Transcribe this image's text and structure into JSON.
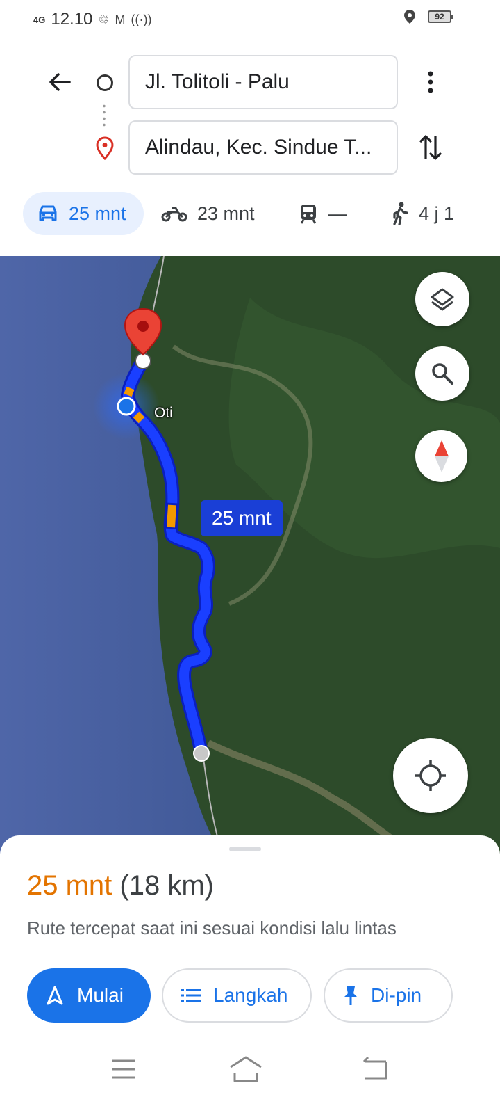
{
  "status_bar": {
    "network": "4G",
    "time": "12.10",
    "battery": "92"
  },
  "directions": {
    "origin": "Jl. Tolitoli - Palu",
    "destination": "Alindau, Kec. Sindue T..."
  },
  "modes": [
    {
      "name": "car",
      "label": "25 mnt",
      "active": true
    },
    {
      "name": "motorcycle",
      "label": "23 mnt",
      "active": false
    },
    {
      "name": "transit",
      "label": "—",
      "active": false
    },
    {
      "name": "walk",
      "label": "4 j 1",
      "active": false
    }
  ],
  "map": {
    "route_label": "25 mnt",
    "place_label": "Oti",
    "route_color": "#1a3fff",
    "traffic_color": "#f29900"
  },
  "sheet": {
    "duration": "25 mnt",
    "distance": "(18 km)",
    "subtitle": "Rute tercepat saat ini sesuai kondisi lalu lintas",
    "start_label": "Mulai",
    "steps_label": "Langkah",
    "pin_label": "Di-pin"
  },
  "icons": {
    "back": "arrow-left-icon",
    "more": "more-vert-icon",
    "swap": "swap-vert-icon",
    "layers": "layers-icon",
    "search": "search-icon",
    "compass": "compass-icon",
    "locate": "my-location-icon"
  },
  "colors": {
    "accent": "#1a73e8",
    "duration": "#e37400"
  }
}
